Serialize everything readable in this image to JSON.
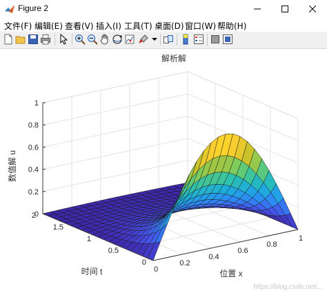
{
  "window": {
    "title": "Figure 2"
  },
  "menu": {
    "items": [
      "文件(F)",
      "编辑(E)",
      "查看(V)",
      "插入(I)",
      "工具(T)",
      "桌面(D)",
      "窗口(W)",
      "帮助(H)"
    ]
  },
  "toolbar": {
    "icons": [
      "new-figure-icon",
      "open-file-icon",
      "save-icon",
      "print-icon",
      "arrow-pointer-icon",
      "zoom-in-icon",
      "zoom-out-icon",
      "pan-hand-icon",
      "rotate-3d-icon",
      "data-cursor-icon",
      "brush-icon",
      "link-plot-icon",
      "colorbar-icon",
      "legend-icon",
      "hide-plot-tools-icon",
      "show-plot-tools-icon"
    ]
  },
  "chart_data": {
    "type": "surface",
    "title": "解析解",
    "xlabel": "位置 x",
    "ylabel": "时间 t",
    "zlabel": "数值解 u",
    "xlim": [
      0,
      1
    ],
    "ylim": [
      0,
      2
    ],
    "zlim": [
      0,
      1
    ],
    "x_ticks": [
      "0",
      "0.2",
      "0.4",
      "0.6",
      "0.8",
      "1"
    ],
    "y_ticks": [
      "0",
      "0.5",
      "1",
      "1.5",
      "2"
    ],
    "z_ticks": [
      "0",
      "0.2",
      "0.4",
      "0.6",
      "0.8",
      "1"
    ],
    "function": "u(x,t) = sin(pi*x) * exp(-0.25*pi^2*t) (peak 1 at x=0.5, t=0; about 0.085 at t=1)",
    "grid": true,
    "colormap": "parula",
    "colors": {
      "low": "#3e26a8",
      "mid": "#2fb7a0",
      "high": "#f9fb15"
    }
  },
  "watermark": "https://blog.csdn.net/..."
}
